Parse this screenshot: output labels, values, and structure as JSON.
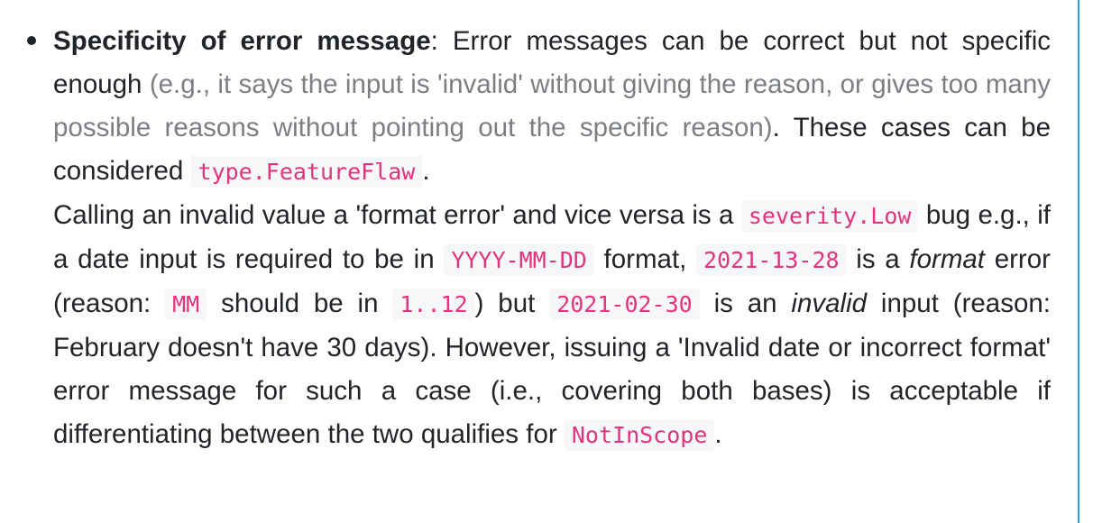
{
  "item": {
    "heading": "Specificity of error message",
    "colon": ":",
    "p1_intro": " Error messages can be correct but not specific enough ",
    "p1_muted": "(e.g., it says the input is 'invalid' without giving the reason, or gives too many possible reasons without pointing out the specific reason)",
    "p1_after": ". These cases can be considered ",
    "code_featureflaw": "type.FeatureFlaw",
    "p1_end": ".",
    "p2_a": "Calling an invalid value a 'format error' and vice versa is a ",
    "code_severity": "severity.Low",
    "p2_b": " bug e.g., if a date input is required to be in ",
    "code_format": "YYYY-MM-DD",
    "p2_c": " format, ",
    "code_date1": "2021-13-28",
    "p2_d": " is a ",
    "em_format": "format",
    "p2_e": " error (reason: ",
    "code_mm": "MM",
    "p2_f": " should be in ",
    "code_range": "1..12",
    "p2_g": ") but ",
    "code_date2": "2021-02-30",
    "p2_h": " is an ",
    "em_invalid": "invalid",
    "p2_i": " input (reason: February doesn't have 30 days). However, issuing a 'Invalid date or incorrect format' error message for such a case (i.e., covering both bases) is acceptable if differentiating between the two qualifies for ",
    "code_notinscope": "NotInScope",
    "p2_end": "."
  }
}
